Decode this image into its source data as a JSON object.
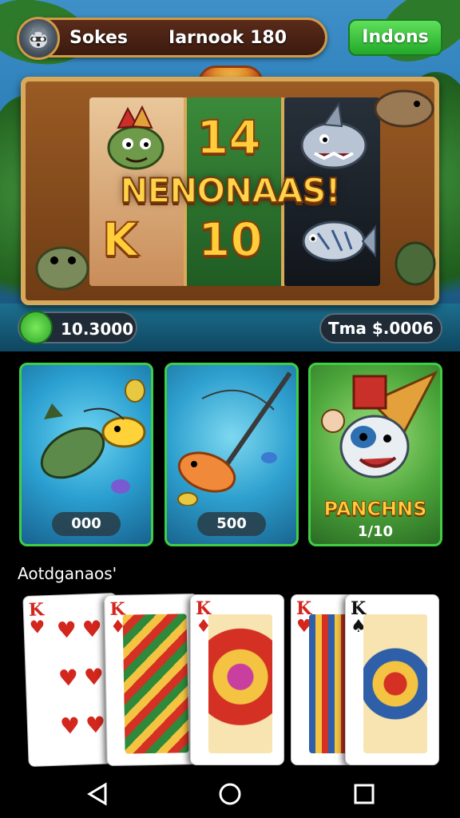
{
  "header": {
    "player_name": "Sokes",
    "balance_label": "Iarnook 180",
    "action_button": "Indons"
  },
  "slot": {
    "reel_symbols": [
      "14",
      "K",
      "10"
    ],
    "win_banner": "NENONAAS!"
  },
  "wallet": {
    "left_value": "10.3000",
    "right_value": "Tma $.0006"
  },
  "game_cards": [
    {
      "price": "000"
    },
    {
      "price": "500"
    },
    {
      "title": "PANCHNS",
      "price": "1/10"
    }
  ],
  "section": {
    "title": "Aotdganaos'"
  },
  "playing_cards": [
    {
      "rank": "K",
      "suit": "♥"
    },
    {
      "rank": "K",
      "suit": "♦"
    },
    {
      "rank": "K",
      "suit": "♦"
    },
    {
      "rank": "K",
      "suit": "♥"
    },
    {
      "rank": "K",
      "suit": "♠"
    }
  ],
  "colors": {
    "accent_green": "#23a829",
    "gold": "#ffce3a",
    "frame_wood": "#9a5b24"
  }
}
